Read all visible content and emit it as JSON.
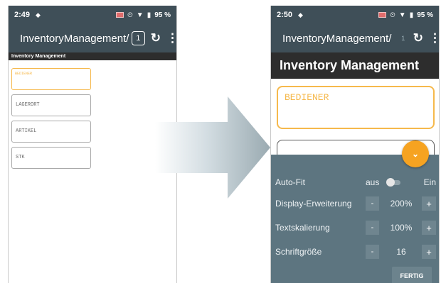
{
  "colors": {
    "bar": "#3f4f58",
    "accent": "#f6b94c",
    "fab": "#f6a321",
    "panel": "#5d7580"
  },
  "left_phone": {
    "status": {
      "time": "2:49",
      "battery": "95 %"
    },
    "app_title": "InventoryManagement/",
    "badge_count": "1",
    "page_header": "Inventory Management",
    "fields": [
      "BEDIENER",
      "LAGERORT",
      "ARTIKEL",
      "STK"
    ]
  },
  "arrow": {
    "icon": "right-arrow"
  },
  "right_phone": {
    "status": {
      "time": "2:50",
      "battery": "95 %"
    },
    "app_title": "InventoryManagement/",
    "badge_count": "1",
    "page_header": "Inventory Management",
    "field": "BEDIENER",
    "panel": {
      "autofit": {
        "label": "Auto-Fit",
        "off": "aus",
        "on": "Ein",
        "enabled": false
      },
      "display_ext": {
        "label": "Display-Erweiterung",
        "minus": "-",
        "value": "200%",
        "plus": "+"
      },
      "text_scale": {
        "label": "Textskalierung",
        "minus": "-",
        "value": "100%",
        "plus": "+"
      },
      "font_size": {
        "label": "Schriftgröße",
        "minus": "-",
        "value": "16",
        "plus": "+"
      },
      "done": "FERTIG"
    }
  }
}
